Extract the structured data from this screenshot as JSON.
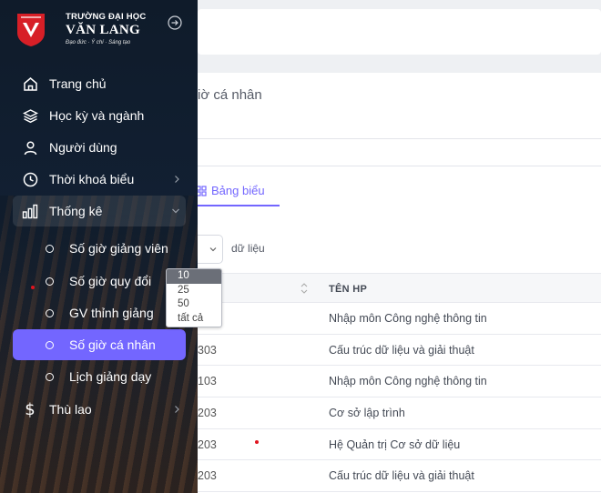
{
  "sidebar": {
    "logo": {
      "line1": "TRƯỜNG ĐẠI HỌC",
      "line2": "VĂN LANG",
      "tagline": "Đạo đức · Ý chí · Sáng tạo"
    },
    "items": [
      {
        "label": "Trang chủ",
        "icon": "home-icon"
      },
      {
        "label": "Học kỳ và ngành",
        "icon": "layers-icon"
      },
      {
        "label": "Người dùng",
        "icon": "user-icon"
      },
      {
        "label": "Thời khoá biểu",
        "icon": "clock-icon"
      },
      {
        "label": "Thống kê",
        "icon": "bar-chart-icon"
      },
      {
        "label": "Thù lao",
        "icon": "dollar-icon"
      }
    ],
    "sub_items": [
      {
        "label": "Số giờ giảng viên"
      },
      {
        "label": "Số giờ quy đổi"
      },
      {
        "label": "GV thỉnh giảng"
      },
      {
        "label": "Số giờ cá nhân",
        "active": true
      },
      {
        "label": "Lịch giảng dạy"
      }
    ]
  },
  "main": {
    "title_fragment": "iờ cá nhân",
    "tab_label": "Bảng biểu",
    "page_size_suffix": "dữ liệu",
    "page_size_options": [
      "10",
      "25",
      "50",
      "tất cả"
    ],
    "selected_page_size": "10",
    "table": {
      "col_header": "TÊN HP",
      "rows": [
        {
          "code": "",
          "name": "Nhập môn Công nghệ thông tin"
        },
        {
          "code": "303",
          "name": "Cấu trúc dữ liệu và giải thuật"
        },
        {
          "code": "103",
          "name": "Nhập môn Công nghệ thông tin"
        },
        {
          "code": "203",
          "name": "Cơ sở lập trình"
        },
        {
          "code": "203",
          "name": "Hệ Quản trị Cơ sở dữ liệu"
        },
        {
          "code": "203",
          "name": "Cấu trúc dữ liệu và giải thuật"
        }
      ]
    }
  },
  "colors": {
    "accent": "#7366ff",
    "brand_red": "#d71f27",
    "sidebar_bg": "#0f1b2a"
  }
}
